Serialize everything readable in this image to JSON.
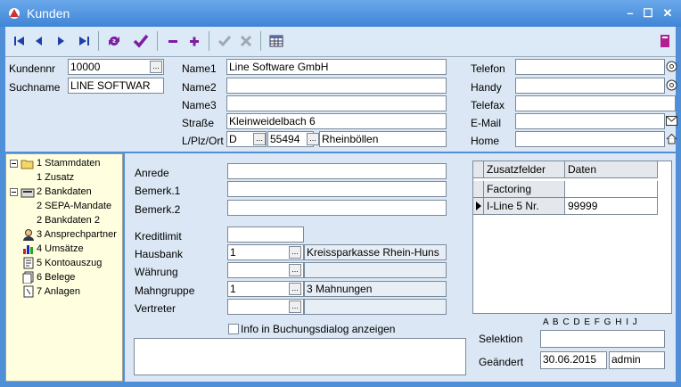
{
  "window": {
    "title": "Kunden"
  },
  "header": {
    "kundennr_label": "Kundennr",
    "kundennr_value": "10000",
    "suchname_label": "Suchname",
    "suchname_value": "LINE SOFTWAR",
    "name1_label": "Name1",
    "name1_value": "Line Software GmbH",
    "name2_label": "Name2",
    "name3_label": "Name3",
    "strasse_label": "Straße",
    "strasse_value": "Kleinweidelbach 6",
    "lplzort_label": "L/Plz/Ort",
    "land_value": "D",
    "plz_value": "55494",
    "ort_value": "Rheinböllen",
    "telefon_label": "Telefon",
    "handy_label": "Handy",
    "telefax_label": "Telefax",
    "email_label": "E-Mail",
    "home_label": "Home"
  },
  "tree": {
    "items": [
      {
        "label": "1 Stammdaten"
      },
      {
        "label": "1 Zusatz"
      },
      {
        "label": "2 Bankdaten"
      },
      {
        "label": "2 SEPA-Mandate"
      },
      {
        "label": "2 Bankdaten 2"
      },
      {
        "label": "3 Ansprechpartner"
      },
      {
        "label": "4 Umsätze"
      },
      {
        "label": "5 Kontoauszug"
      },
      {
        "label": "6 Belege"
      },
      {
        "label": "7 Anlagen"
      }
    ]
  },
  "main": {
    "anrede_label": "Anrede",
    "bemerk1_label": "Bemerk.1",
    "bemerk2_label": "Bemerk.2",
    "kreditlimit_label": "Kreditlimit",
    "hausbank_label": "Hausbank",
    "hausbank_value": "1",
    "hausbank_desc": "Kreissparkasse Rhein-Huns",
    "waehrung_label": "Währung",
    "mahngruppe_label": "Mahngruppe",
    "mahngruppe_value": "1",
    "mahngruppe_desc": "3 Mahnungen",
    "vertreter_label": "Vertreter",
    "info_checkbox_label": "Info in Buchungsdialog anzeigen"
  },
  "zusatz": {
    "col1": "Zusatzfelder",
    "col2": "Daten",
    "rows": [
      {
        "field": "Factoring",
        "value": ""
      },
      {
        "field": "I-Line 5 Nr.",
        "value": "99999"
      }
    ]
  },
  "footer": {
    "letters": "A B C D E F G H I J",
    "selektion_label": "Selektion",
    "geaendert_label": "Geändert",
    "geaendert_date": "30.06.2015",
    "geaendert_user": "admin"
  }
}
